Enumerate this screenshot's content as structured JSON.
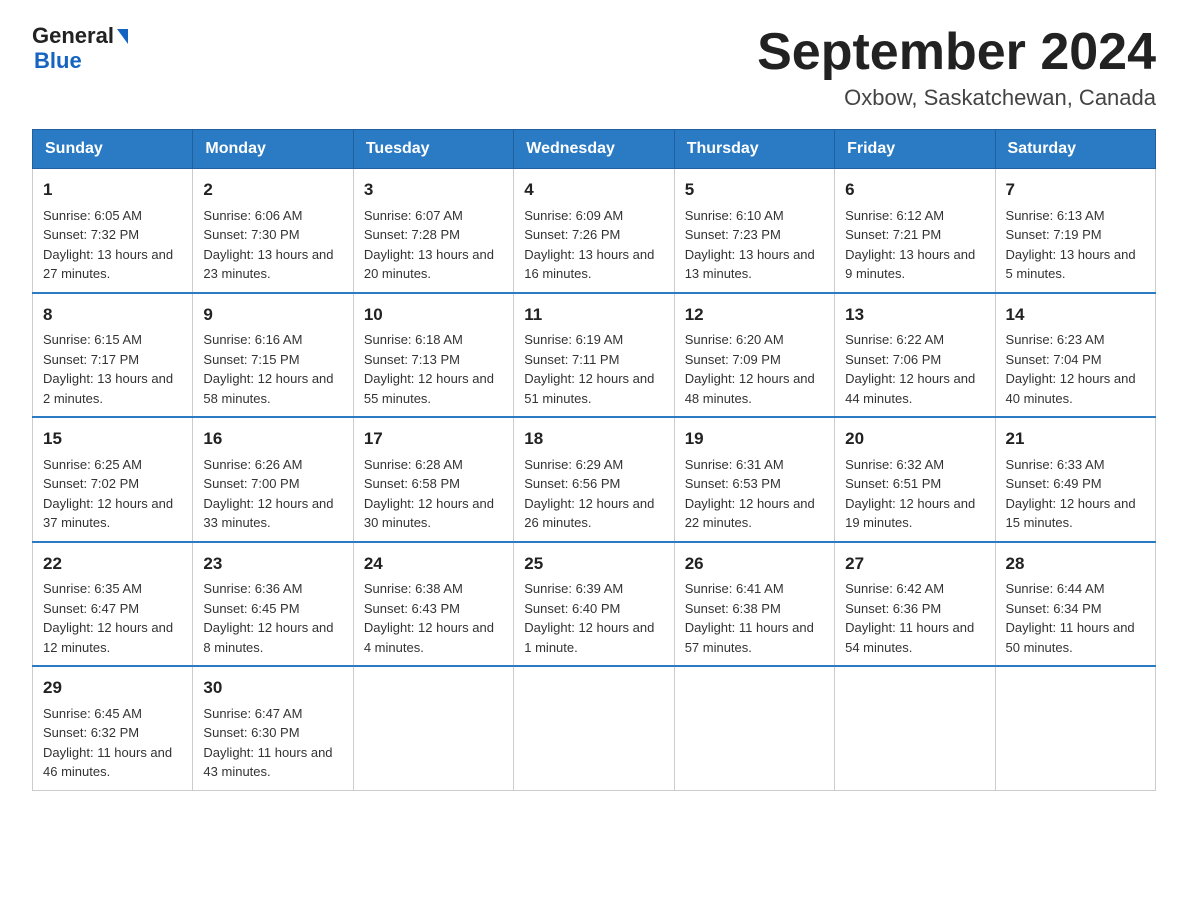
{
  "logo": {
    "line1": "General",
    "arrow": true,
    "line2": "Blue"
  },
  "title": "September 2024",
  "location": "Oxbow, Saskatchewan, Canada",
  "headers": [
    "Sunday",
    "Monday",
    "Tuesday",
    "Wednesday",
    "Thursday",
    "Friday",
    "Saturday"
  ],
  "weeks": [
    [
      {
        "day": "1",
        "sunrise": "6:05 AM",
        "sunset": "7:32 PM",
        "daylight": "13 hours and 27 minutes."
      },
      {
        "day": "2",
        "sunrise": "6:06 AM",
        "sunset": "7:30 PM",
        "daylight": "13 hours and 23 minutes."
      },
      {
        "day": "3",
        "sunrise": "6:07 AM",
        "sunset": "7:28 PM",
        "daylight": "13 hours and 20 minutes."
      },
      {
        "day": "4",
        "sunrise": "6:09 AM",
        "sunset": "7:26 PM",
        "daylight": "13 hours and 16 minutes."
      },
      {
        "day": "5",
        "sunrise": "6:10 AM",
        "sunset": "7:23 PM",
        "daylight": "13 hours and 13 minutes."
      },
      {
        "day": "6",
        "sunrise": "6:12 AM",
        "sunset": "7:21 PM",
        "daylight": "13 hours and 9 minutes."
      },
      {
        "day": "7",
        "sunrise": "6:13 AM",
        "sunset": "7:19 PM",
        "daylight": "13 hours and 5 minutes."
      }
    ],
    [
      {
        "day": "8",
        "sunrise": "6:15 AM",
        "sunset": "7:17 PM",
        "daylight": "13 hours and 2 minutes."
      },
      {
        "day": "9",
        "sunrise": "6:16 AM",
        "sunset": "7:15 PM",
        "daylight": "12 hours and 58 minutes."
      },
      {
        "day": "10",
        "sunrise": "6:18 AM",
        "sunset": "7:13 PM",
        "daylight": "12 hours and 55 minutes."
      },
      {
        "day": "11",
        "sunrise": "6:19 AM",
        "sunset": "7:11 PM",
        "daylight": "12 hours and 51 minutes."
      },
      {
        "day": "12",
        "sunrise": "6:20 AM",
        "sunset": "7:09 PM",
        "daylight": "12 hours and 48 minutes."
      },
      {
        "day": "13",
        "sunrise": "6:22 AM",
        "sunset": "7:06 PM",
        "daylight": "12 hours and 44 minutes."
      },
      {
        "day": "14",
        "sunrise": "6:23 AM",
        "sunset": "7:04 PM",
        "daylight": "12 hours and 40 minutes."
      }
    ],
    [
      {
        "day": "15",
        "sunrise": "6:25 AM",
        "sunset": "7:02 PM",
        "daylight": "12 hours and 37 minutes."
      },
      {
        "day": "16",
        "sunrise": "6:26 AM",
        "sunset": "7:00 PM",
        "daylight": "12 hours and 33 minutes."
      },
      {
        "day": "17",
        "sunrise": "6:28 AM",
        "sunset": "6:58 PM",
        "daylight": "12 hours and 30 minutes."
      },
      {
        "day": "18",
        "sunrise": "6:29 AM",
        "sunset": "6:56 PM",
        "daylight": "12 hours and 26 minutes."
      },
      {
        "day": "19",
        "sunrise": "6:31 AM",
        "sunset": "6:53 PM",
        "daylight": "12 hours and 22 minutes."
      },
      {
        "day": "20",
        "sunrise": "6:32 AM",
        "sunset": "6:51 PM",
        "daylight": "12 hours and 19 minutes."
      },
      {
        "day": "21",
        "sunrise": "6:33 AM",
        "sunset": "6:49 PM",
        "daylight": "12 hours and 15 minutes."
      }
    ],
    [
      {
        "day": "22",
        "sunrise": "6:35 AM",
        "sunset": "6:47 PM",
        "daylight": "12 hours and 12 minutes."
      },
      {
        "day": "23",
        "sunrise": "6:36 AM",
        "sunset": "6:45 PM",
        "daylight": "12 hours and 8 minutes."
      },
      {
        "day": "24",
        "sunrise": "6:38 AM",
        "sunset": "6:43 PM",
        "daylight": "12 hours and 4 minutes."
      },
      {
        "day": "25",
        "sunrise": "6:39 AM",
        "sunset": "6:40 PM",
        "daylight": "12 hours and 1 minute."
      },
      {
        "day": "26",
        "sunrise": "6:41 AM",
        "sunset": "6:38 PM",
        "daylight": "11 hours and 57 minutes."
      },
      {
        "day": "27",
        "sunrise": "6:42 AM",
        "sunset": "6:36 PM",
        "daylight": "11 hours and 54 minutes."
      },
      {
        "day": "28",
        "sunrise": "6:44 AM",
        "sunset": "6:34 PM",
        "daylight": "11 hours and 50 minutes."
      }
    ],
    [
      {
        "day": "29",
        "sunrise": "6:45 AM",
        "sunset": "6:32 PM",
        "daylight": "11 hours and 46 minutes."
      },
      {
        "day": "30",
        "sunrise": "6:47 AM",
        "sunset": "6:30 PM",
        "daylight": "11 hours and 43 minutes."
      },
      null,
      null,
      null,
      null,
      null
    ]
  ]
}
